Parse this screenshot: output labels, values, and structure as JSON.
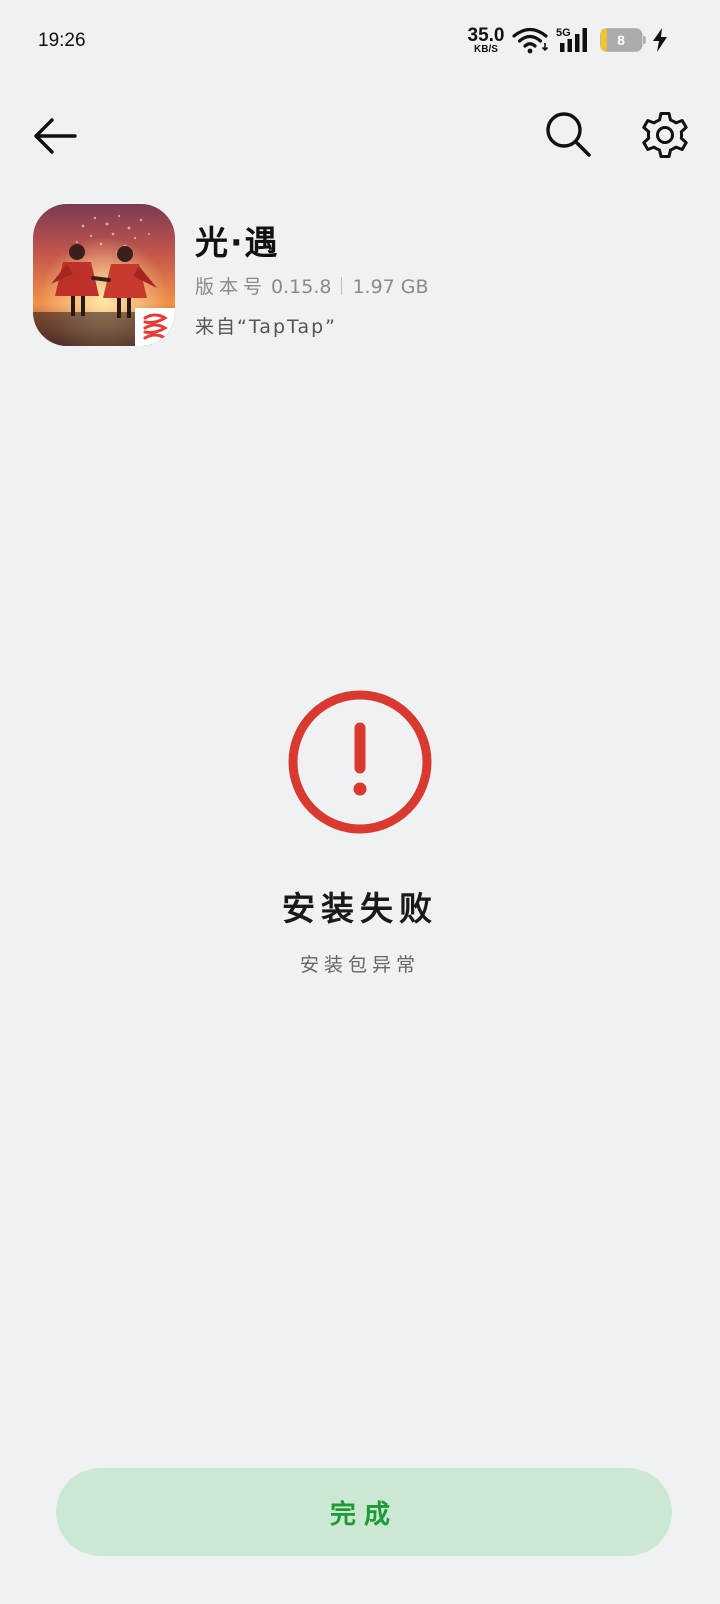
{
  "status_bar": {
    "time": "19:26",
    "net_speed_value": "35.0",
    "net_speed_unit": "KB/S",
    "network_type": "5G",
    "battery_level": "8"
  },
  "nav": {
    "back_icon": "arrow-left-icon",
    "search_icon": "search-icon",
    "settings_icon": "gear-icon"
  },
  "app": {
    "name": "光·遇",
    "version_label": "版本号",
    "version": "0.15.8",
    "size": "1.97 GB",
    "source": "来自“TapTap”"
  },
  "result": {
    "icon": "exclamation-circle-icon",
    "title": "安装失败",
    "reason": "安装包异常"
  },
  "done_button": {
    "label": "完成"
  },
  "colors": {
    "background": "#f0f1f3",
    "error": "#d93a30",
    "button_bg": "#cbe8d2",
    "button_text": "#1f9a34"
  }
}
